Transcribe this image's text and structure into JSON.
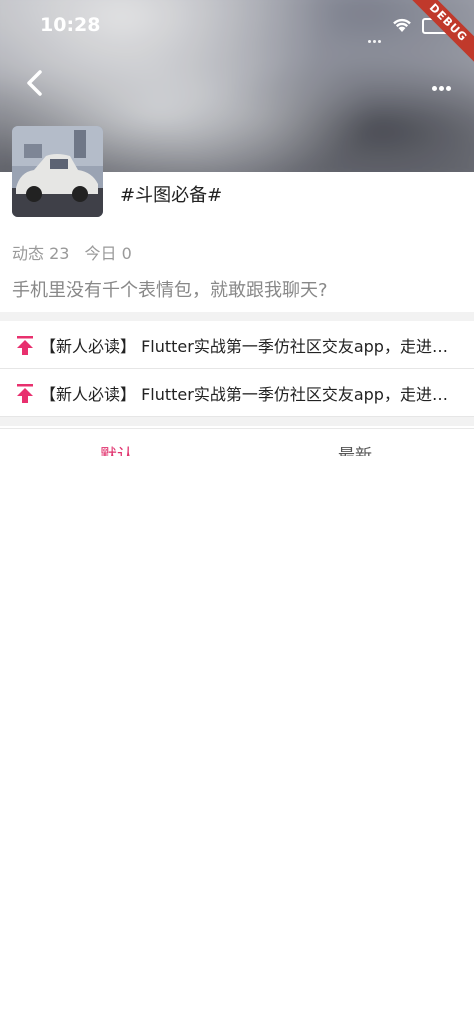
{
  "status_bar": {
    "time": "10:28",
    "debug_label": "DEBUG"
  },
  "topic": {
    "title": "#斗图必备#",
    "stats": {
      "posts_label": "动态 23",
      "today_label": "今日 0"
    },
    "description": "手机里没有千个表情包，就敢跟我聊天?"
  },
  "notices": [
    {
      "text": "【新人必读】 Flutter实战第一季仿社区交友app，走进Flutter开发"
    },
    {
      "text": "【新人必读】 Flutter实战第一季仿社区交友app，走进Flutter开发"
    }
  ],
  "tabs": [
    {
      "label": "默认",
      "active": true
    },
    {
      "label": "最新",
      "active": false
    }
  ],
  "colors": {
    "accent": "#e0306c",
    "pin": "#e8306e"
  },
  "icons": [
    "back-arrow-icon",
    "more-icon",
    "wifi-icon",
    "battery-icon",
    "pin-top-icon"
  ]
}
